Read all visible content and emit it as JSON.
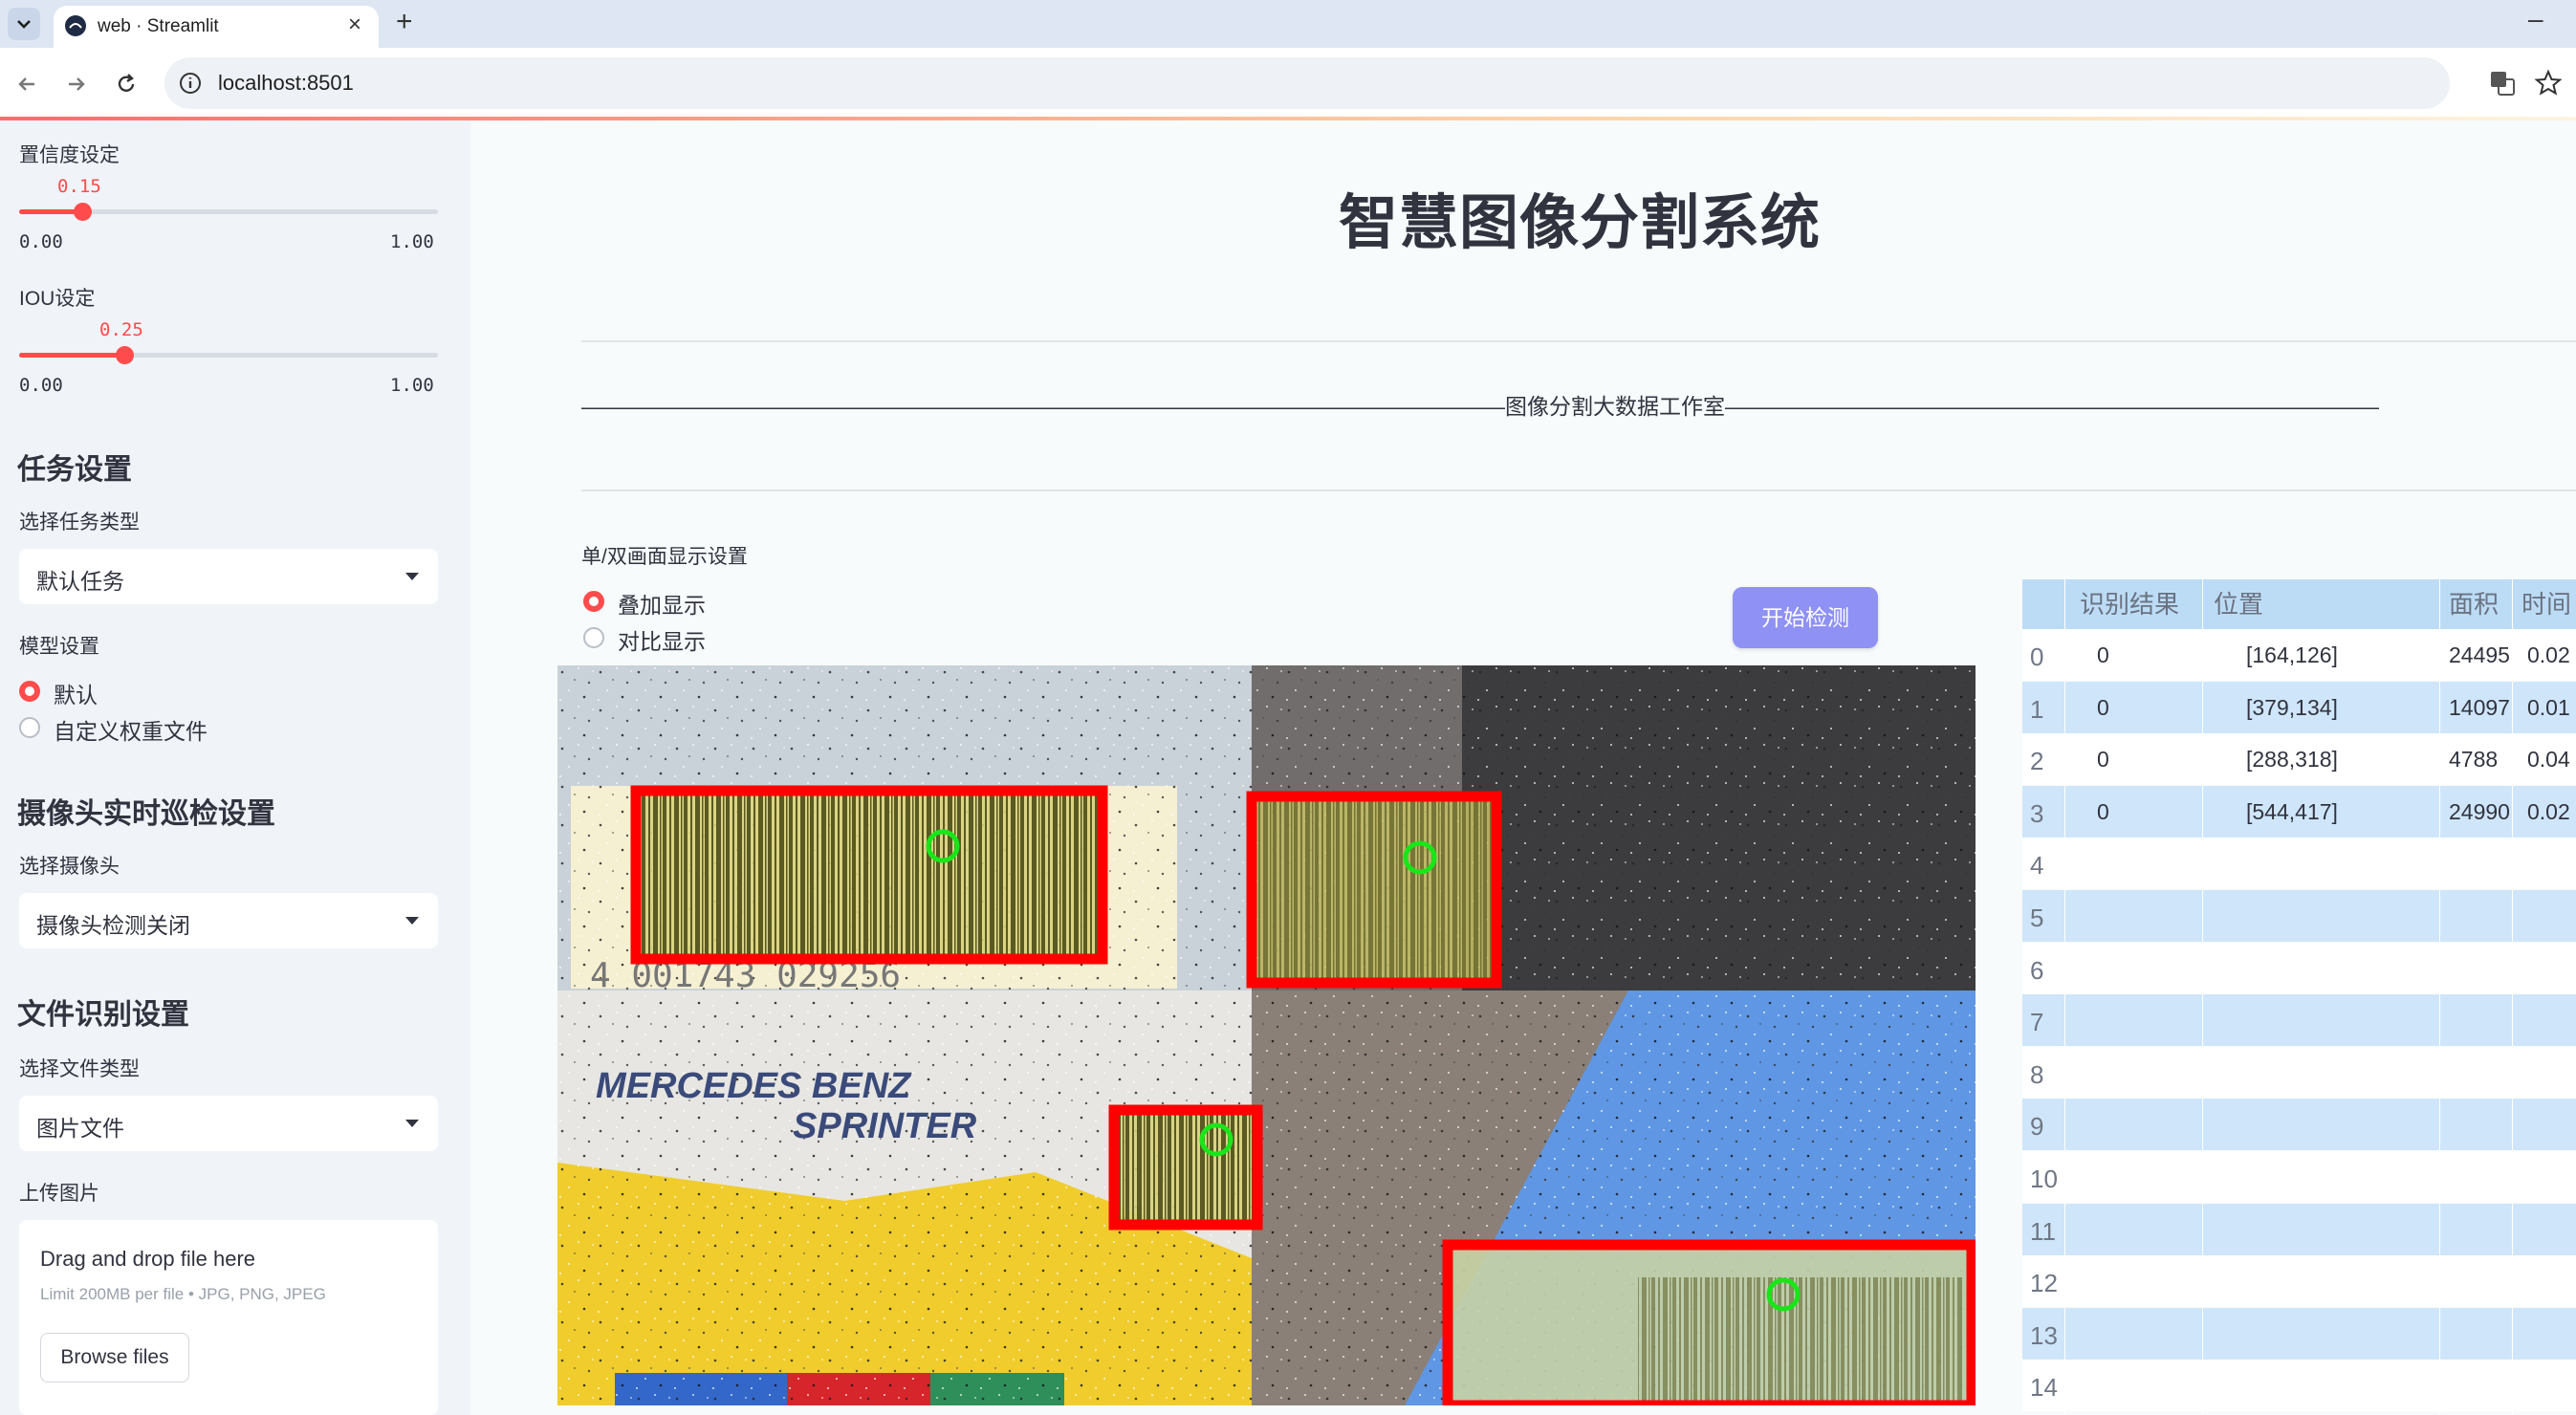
{
  "browser": {
    "tab_title": "web · Streamlit",
    "url": "localhost:8501"
  },
  "sidebar": {
    "confidence": {
      "label": "置信度设定",
      "value": "0.15",
      "min": "0.00",
      "max": "1.00",
      "fraction": 0.15
    },
    "iou": {
      "label": "IOU设定",
      "value": "0.25",
      "min": "0.00",
      "max": "1.00",
      "fraction": 0.25
    },
    "task_heading": "任务设置",
    "task_type_label": "选择任务类型",
    "task_type_value": "默认任务",
    "model_label": "模型设置",
    "model_options": [
      "默认",
      "自定义权重文件"
    ],
    "camera_heading": "摄像头实时巡检设置",
    "camera_label": "选择摄像头",
    "camera_value": "摄像头检测关闭",
    "file_heading": "文件识别设置",
    "file_type_label": "选择文件类型",
    "file_type_value": "图片文件",
    "upload_label": "上传图片",
    "upload": {
      "title": "Drag and drop file here",
      "hint": "Limit 200MB per file • JPG, PNG, JPEG",
      "button": "Browse files"
    }
  },
  "main": {
    "title": "智慧图像分割系统",
    "subtitle": "——————————————————————————————————————————图像分割大数据工作室———————————————————————————————————————————",
    "display_label": "单/双画面显示设置",
    "display_options": [
      "叠加显示",
      "对比显示"
    ],
    "detect_button": "开始检测",
    "image_text": {
      "line1": "MERCEDES BENZ",
      "line2": "SPRINTER",
      "barcode_digits": "4 001743 029256"
    },
    "detections": [
      {
        "label": "0"
      },
      {
        "label": "0"
      },
      {
        "label": "0"
      },
      {
        "label": "0"
      }
    ]
  },
  "table": {
    "headers": [
      "识别结果",
      "位置",
      "面积",
      "时间"
    ],
    "rows": [
      {
        "index": "0",
        "result": "0",
        "position": "[164,126]",
        "area": "24495",
        "time": "0.02"
      },
      {
        "index": "1",
        "result": "0",
        "position": "[379,134]",
        "area": "14097",
        "time": "0.01"
      },
      {
        "index": "2",
        "result": "0",
        "position": "[288,318]",
        "area": "4788",
        "time": "0.04"
      },
      {
        "index": "3",
        "result": "0",
        "position": "[544,417]",
        "area": "24990",
        "time": "0.02"
      },
      {
        "index": "4"
      },
      {
        "index": "5"
      },
      {
        "index": "6"
      },
      {
        "index": "7"
      },
      {
        "index": "8"
      },
      {
        "index": "9"
      },
      {
        "index": "10"
      },
      {
        "index": "11"
      },
      {
        "index": "12"
      },
      {
        "index": "13"
      },
      {
        "index": "14"
      }
    ]
  },
  "colors": {
    "accent": "#ff4b4b",
    "button": "#8f91f5",
    "box": "#ff0000",
    "marker": "#19e619",
    "table_stripe": "#cfe6fa",
    "table_header": "#bcdcf6"
  }
}
